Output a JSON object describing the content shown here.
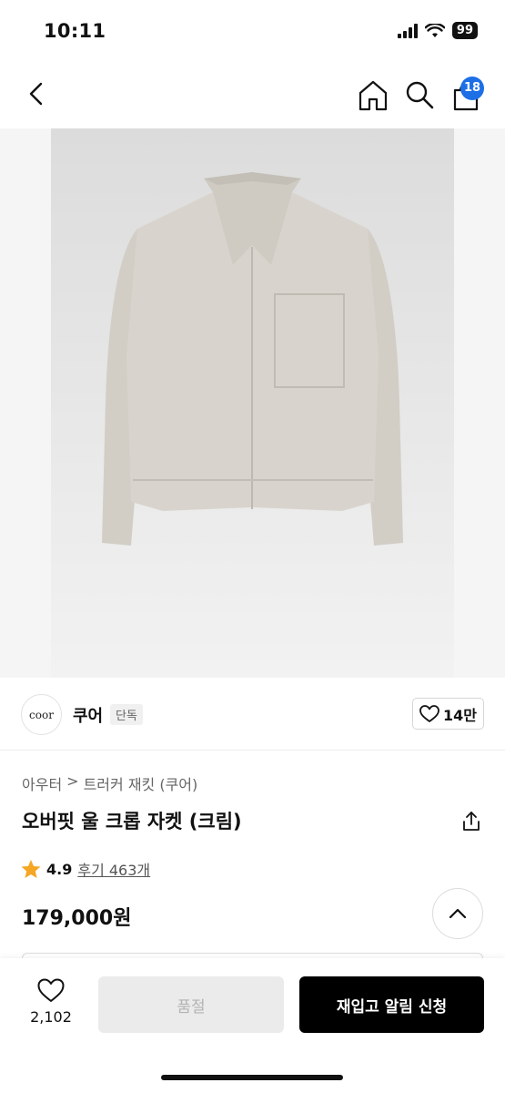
{
  "status_bar": {
    "time": "10:11",
    "battery": "99"
  },
  "nav": {
    "cart_count": "18"
  },
  "brand": {
    "logo_text": "coor",
    "name": "쿠어",
    "tag": "단독",
    "likes": "14만"
  },
  "breadcrumb": {
    "category": "아우터",
    "separator": ">",
    "sub": "트러커 재킷 (쿠어)"
  },
  "product": {
    "title": "오버핏 울 크롭 자켓 (크림)",
    "rating": "4.9",
    "review_label": "후기 463개",
    "price": "179,000원",
    "image_desc_icon": "jacket-image"
  },
  "bottom": {
    "wish_count": "2,102",
    "soldout_label": "품절",
    "restock_label": "재입고 알림 신청"
  },
  "colors": {
    "accent_blue": "#1d6fe6",
    "star": "#f5a623",
    "jacket": "#d6d2cb"
  }
}
